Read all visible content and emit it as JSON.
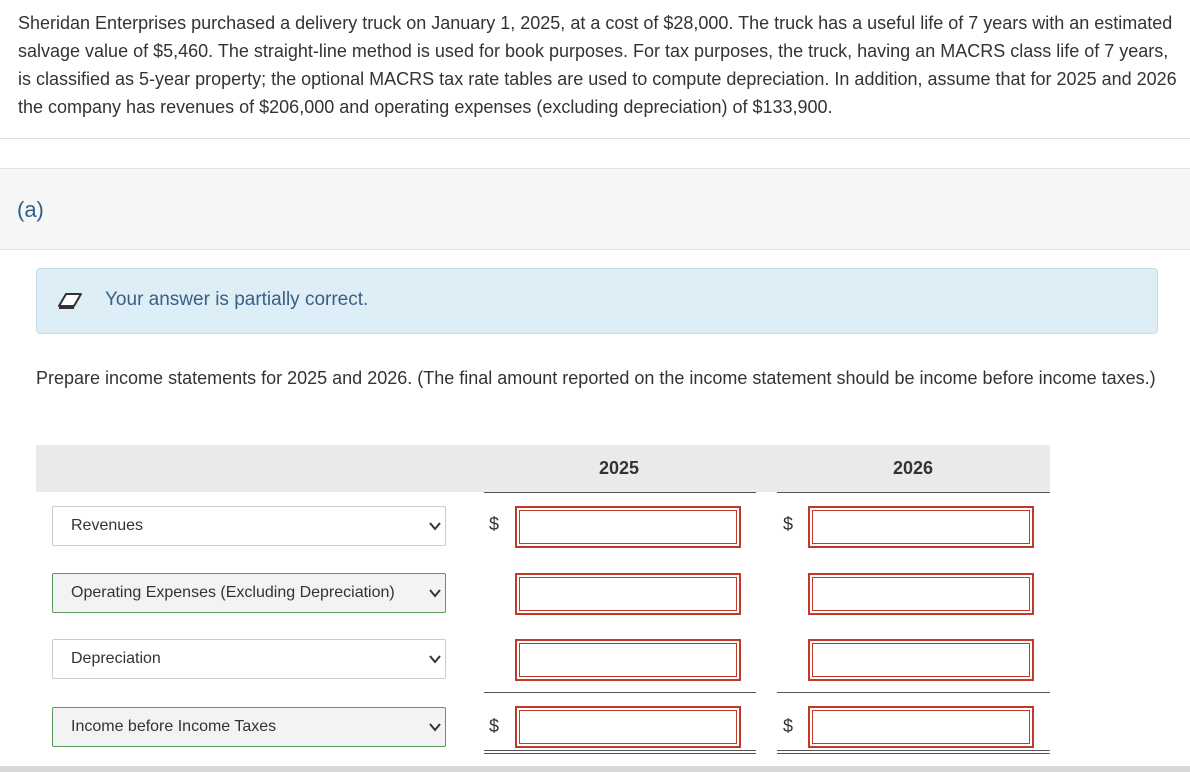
{
  "problem": {
    "text": "Sheridan Enterprises purchased a delivery truck on January 1, 2025, at a cost of $28,000. The truck has a useful life of 7 years with an estimated salvage value of $5,460. The straight-line method is used for book purposes. For tax purposes, the truck, having an MACRS class life of 7 years, is classified as 5-year property; the optional MACRS tax rate tables are used to compute depreciation. In addition, assume that for 2025 and 2026 the company has revenues of $206,000 and operating expenses (excluding depreciation) of $133,900."
  },
  "part": {
    "label": "(a)"
  },
  "status": {
    "icon": "pencil-icon",
    "text": "Your answer is partially correct."
  },
  "instructions": "Prepare income statements for 2025 and 2026. (The final amount reported on the income statement should be income before income taxes.)",
  "table": {
    "columns": [
      "2025",
      "2026"
    ],
    "currency_symbol": "$",
    "rows": [
      {
        "label": "Revenues",
        "select_state": "neutral",
        "value_2025": "",
        "value_2026": ""
      },
      {
        "label": "Operating Expenses (Excluding Depreciation)",
        "select_state": "correct",
        "value_2025": "",
        "value_2026": ""
      },
      {
        "label": "Depreciation",
        "select_state": "neutral",
        "value_2025": "",
        "value_2026": ""
      },
      {
        "label": "Income before Income Taxes",
        "select_state": "correct",
        "value_2025": "",
        "value_2026": ""
      }
    ]
  },
  "colors": {
    "incorrect_border": "#c0392b",
    "correct_border": "#5d9a5d",
    "status_bg": "#deeef7",
    "part_label": "#2f5f8f"
  }
}
